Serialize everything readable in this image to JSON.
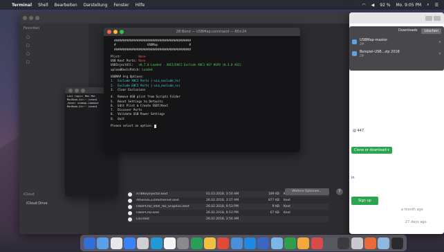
{
  "menubar": {
    "apple": "",
    "app": "Terminal",
    "items": [
      "Shell",
      "Bearbeiten",
      "Darstellung",
      "Fenster",
      "Hilfe"
    ],
    "battery": "92 %",
    "clock": "Mo. 9:05 PM"
  },
  "finder": {
    "sidebar_header": "Favoriten",
    "sidebar_items": [
      "",
      "",
      "",
      "",
      "",
      ""
    ],
    "icloud_header": "iCloud",
    "icloud_item": "iCloud Drive",
    "files": [
      {
        "name": "ATI8KeyInjector.kext",
        "date": "01.03.2018, 3:50 AM",
        "size": "189 KB",
        "kind": "Kext"
      },
      {
        "name": "AtherosE2200Ethernet.kext",
        "date": "26.02.2018, 3:37 AM",
        "size": "877 KB",
        "kind": "Kext"
      },
      {
        "name": "FakePCIID_Intel_HD_Graphics.kext",
        "date": "26.02.2018, 9:53 PM",
        "size": "9 KB",
        "kind": "Kext"
      },
      {
        "name": "FakePCIID.kext",
        "date": "26.02.2018, 9:53 PM",
        "size": "67 KB",
        "kind": "Kext"
      },
      {
        "name": "Lilu.kext",
        "date": "26.02.2018, 3:54 AM",
        "size": "",
        "kind": ""
      }
    ],
    "dropdown_btn": "Weitere Optionen...",
    "help": "?"
  },
  "browser": {
    "title_hint": ""
  },
  "notifications": {
    "head_btn1": "Downloads",
    "head_btn2": "Löschen",
    "items": [
      {
        "title": "USBMap-master",
        "sub": "ZIP"
      },
      {
        "title": "Beispiel-USB...zip 2018",
        "sub": "ZIP"
      }
    ],
    "close": "×"
  },
  "github": {
    "snippet1": "@ 447",
    "clone_btn": "Clone or download ▾",
    "snippet2": "in",
    "signup_btn": "Sign up",
    "ago1": "a month ago",
    "ago2": "27 days ago"
  },
  "term2": {
    "lines": [
      "Last login: Mon Mar",
      "MacBook-Air:~ jonas$",
      "/bash: usbmap.command",
      "MacBook-Air:~ jonas$"
    ]
  },
  "term": {
    "title": "2B Bond — USBMap.command — 80×24",
    "banner1": "  ############################################",
    "banner2": "  #                  USBMap                  #",
    "banner3": "  ############################################",
    "l_plist_k": "Plist:",
    "l_plist_v": "None",
    "l_ports_k": "USB Kext Ports:",
    "l_ports_v": "None",
    "l_usbinj_k": "USBInjectAll:",
    "l_usbinj_v": "v0.7.0 Loaded - XHCI/EHCI Exclude XHC1 HS? HSPO (0.3.0 AGI)",
    "l_patch_k": "uploadKextsPatch:",
    "l_patch_v": "Loaded",
    "opts_head": "USBMAP Arg Options:",
    "opt1": "1.  Exclude XHCI Ports (-uia_exclude_hs)",
    "opt2": "2.  Exclude EHCI Ports (-uia_exclude_ss)",
    "opt3": "3.  Clear Exclusions",
    "act1": "4.  Remove USB plist from Scripts Folder",
    "act2": "5.  Reset Settings to Defaults",
    "act3": "6.  Edit Plist & Create SSDT/Kext",
    "act4": "7.  Discover Ports",
    "act5": "8.  Validate USB Power Settings",
    "act6": "Q.  Quit",
    "prompt": "Please select an option: "
  },
  "dock_colors": [
    "#2f6fd6",
    "#5aa0e8",
    "#e8e8ea",
    "#3b82f6",
    "#d0d0d4",
    "#1f9ad6",
    "#f5f5f5",
    "#8a8a8e",
    "#2a9d5a",
    "#f0c040",
    "#e04a3a",
    "#4a90d9",
    "#1e88e5",
    "#3a66c4",
    "#7ab6e8",
    "#2f9e4a",
    "#f2a93b",
    "#d94b4b",
    "#555a60",
    "#3a3a3f",
    "#c9c9ce",
    "#e86a3a",
    "#8fb8de",
    "#2a2a2c"
  ]
}
